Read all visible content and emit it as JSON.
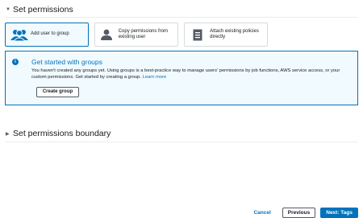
{
  "sections": {
    "permissions": {
      "caret": "▼",
      "title": "Set permissions"
    },
    "boundary": {
      "caret": "▶",
      "title": "Set permissions boundary"
    }
  },
  "options": [
    {
      "label": "Add user to group",
      "icon": "users-group-icon",
      "selected": true
    },
    {
      "label": "Copy permissions from existing user",
      "icon": "user-icon",
      "selected": false
    },
    {
      "label": "Attach existing policies directly",
      "icon": "document-icon",
      "selected": false
    }
  ],
  "info": {
    "icon": "info-icon",
    "title": "Get started with groups",
    "body": "You haven't created any groups yet. Using groups is a best-practice way to manage users' permissions by job functions, AWS service access, or your custom permissions. Get started by creating a group.",
    "link": "Learn more",
    "button": "Create group"
  },
  "footer": {
    "cancel": "Cancel",
    "previous": "Previous",
    "next": "Next: Tags"
  },
  "colors": {
    "accent": "#0073bb",
    "info_bg": "#f1faff",
    "border": "#d5dbdb",
    "text": "#16191f"
  }
}
